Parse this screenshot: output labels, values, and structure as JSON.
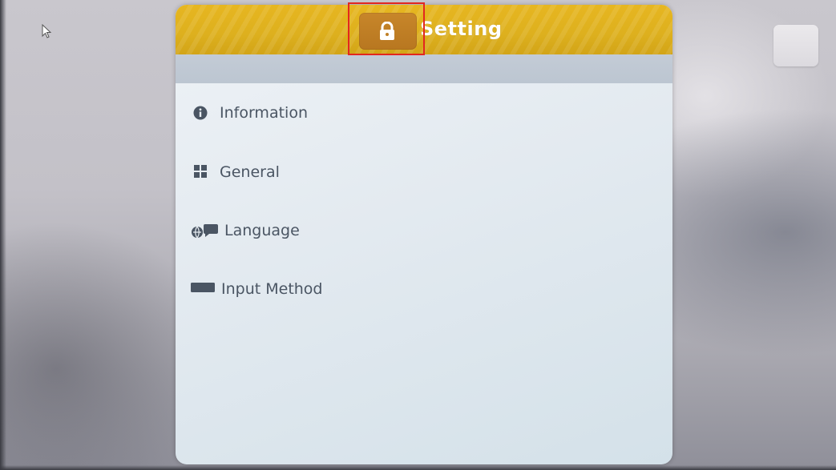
{
  "header": {
    "title": "Setting",
    "lock_icon": "lock-icon"
  },
  "menu": {
    "items": [
      {
        "label": "Information",
        "icon": "info-circle-icon"
      },
      {
        "label": "General",
        "icon": "grid-icon"
      },
      {
        "label": "Language",
        "icon": "language-icon"
      },
      {
        "label": "Input Method",
        "icon": "keyboard-icon"
      }
    ]
  },
  "colors": {
    "header_accent": "#e0b11f",
    "lock_button": "#c07f26",
    "highlight_box": "#e3271f",
    "menu_text": "#4a5563"
  }
}
